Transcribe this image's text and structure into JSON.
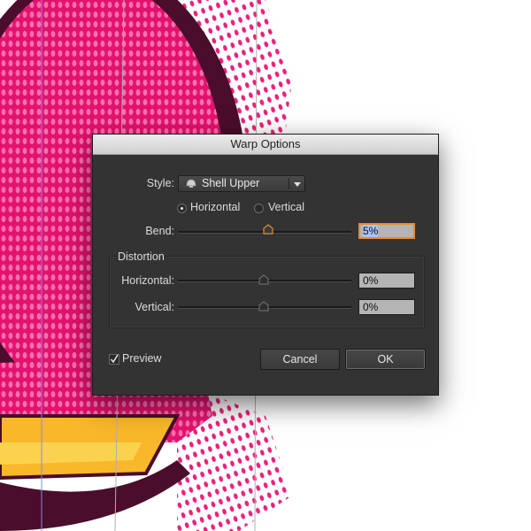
{
  "dialog": {
    "title": "Warp Options",
    "style_label": "Style:",
    "style_value": "Shell Upper",
    "style_icon": "shell-upper-icon",
    "orientation": {
      "horizontal_label": "Horizontal",
      "vertical_label": "Vertical",
      "selected": "Horizontal"
    },
    "bend": {
      "label": "Bend:",
      "value": "5%",
      "slider_percent": 5
    },
    "distortion": {
      "group_label": "Distortion",
      "horizontal": {
        "label": "Horizontal:",
        "value": "0%",
        "slider_percent": 0
      },
      "vertical": {
        "label": "Vertical:",
        "value": "0%",
        "slider_percent": 0
      }
    },
    "preview": {
      "label": "Preview",
      "checked": true
    },
    "buttons": {
      "cancel": "Cancel",
      "ok": "OK"
    }
  },
  "colors": {
    "artwork_magenta": "#e2136e",
    "artwork_pink_dots": "#ff6fb0",
    "artwork_outline": "#4a0d2b",
    "artwork_yellow": "#f9b82a",
    "dialog_bg": "#333333",
    "focus_orange": "#e88b2b"
  }
}
